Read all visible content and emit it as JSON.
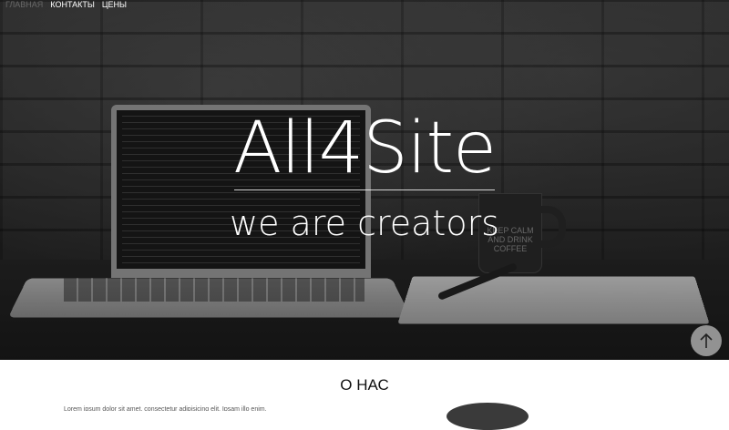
{
  "nav": {
    "items": [
      {
        "label": "ГЛАВНАЯ"
      },
      {
        "label": "КОНТАКТЫ"
      },
      {
        "label": "ЦЕНЫ"
      }
    ]
  },
  "hero": {
    "brand": "All4Site",
    "tagline": "we are creators",
    "mug_text": "KEEP CALM AND DRINK COFFEE"
  },
  "about": {
    "title": "О НАС",
    "text": "Lorem ipsum dolor sit amet, consectetur adipisicing elit. Ipsam illo enim."
  },
  "icons": {
    "to_top": "arrow-up-icon"
  }
}
